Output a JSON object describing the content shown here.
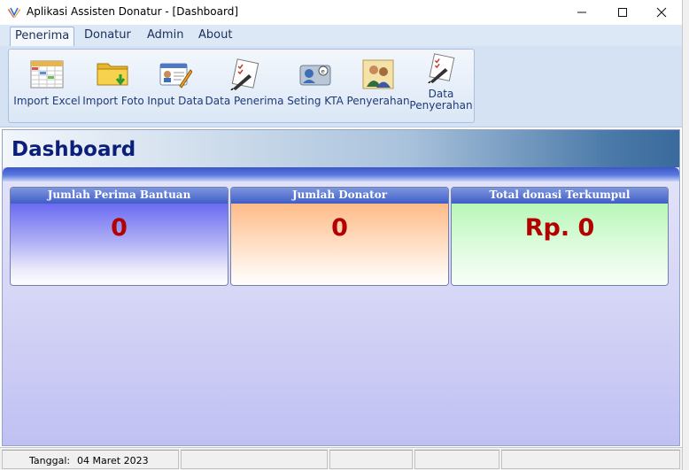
{
  "window": {
    "title": "Aplikasi Assisten Donatur - [Dashboard]",
    "minimize": "—",
    "maximize": "☐",
    "close": "✕"
  },
  "menu": {
    "items": [
      {
        "label": "Penerima",
        "active": true
      },
      {
        "label": "Donatur",
        "active": false
      },
      {
        "label": "Admin",
        "active": false
      },
      {
        "label": "About",
        "active": false
      }
    ]
  },
  "ribbon": {
    "buttons": [
      {
        "label": "Import Excel",
        "icon": "excel-sheet-icon"
      },
      {
        "label": "Import Foto",
        "icon": "folder-download-icon"
      },
      {
        "label": "Input Data",
        "icon": "id-card-edit-icon"
      },
      {
        "label": "Data Penerima",
        "icon": "checklist-pen-icon"
      },
      {
        "label": "Seting KTA",
        "icon": "member-card-icon"
      },
      {
        "label": "Penyerahan",
        "icon": "people-handover-icon"
      },
      {
        "label": "Data Penyerahan",
        "icon": "checklist-pen-icon"
      }
    ]
  },
  "dashboard": {
    "title": "Dashboard",
    "cards": [
      {
        "header": "Jumlah Perima Bantuan",
        "value": "0"
      },
      {
        "header": "Jumlah Donator",
        "value": "0"
      },
      {
        "header": "Total donasi Terkumpul",
        "value": "Rp. 0"
      }
    ]
  },
  "statusbar": {
    "date_label": "Tanggal:",
    "date_value": "04 Maret 2023"
  },
  "colors": {
    "accent_title": "#0b1f7a",
    "value_red": "#b30000",
    "card_header": "#3f5ec7"
  }
}
